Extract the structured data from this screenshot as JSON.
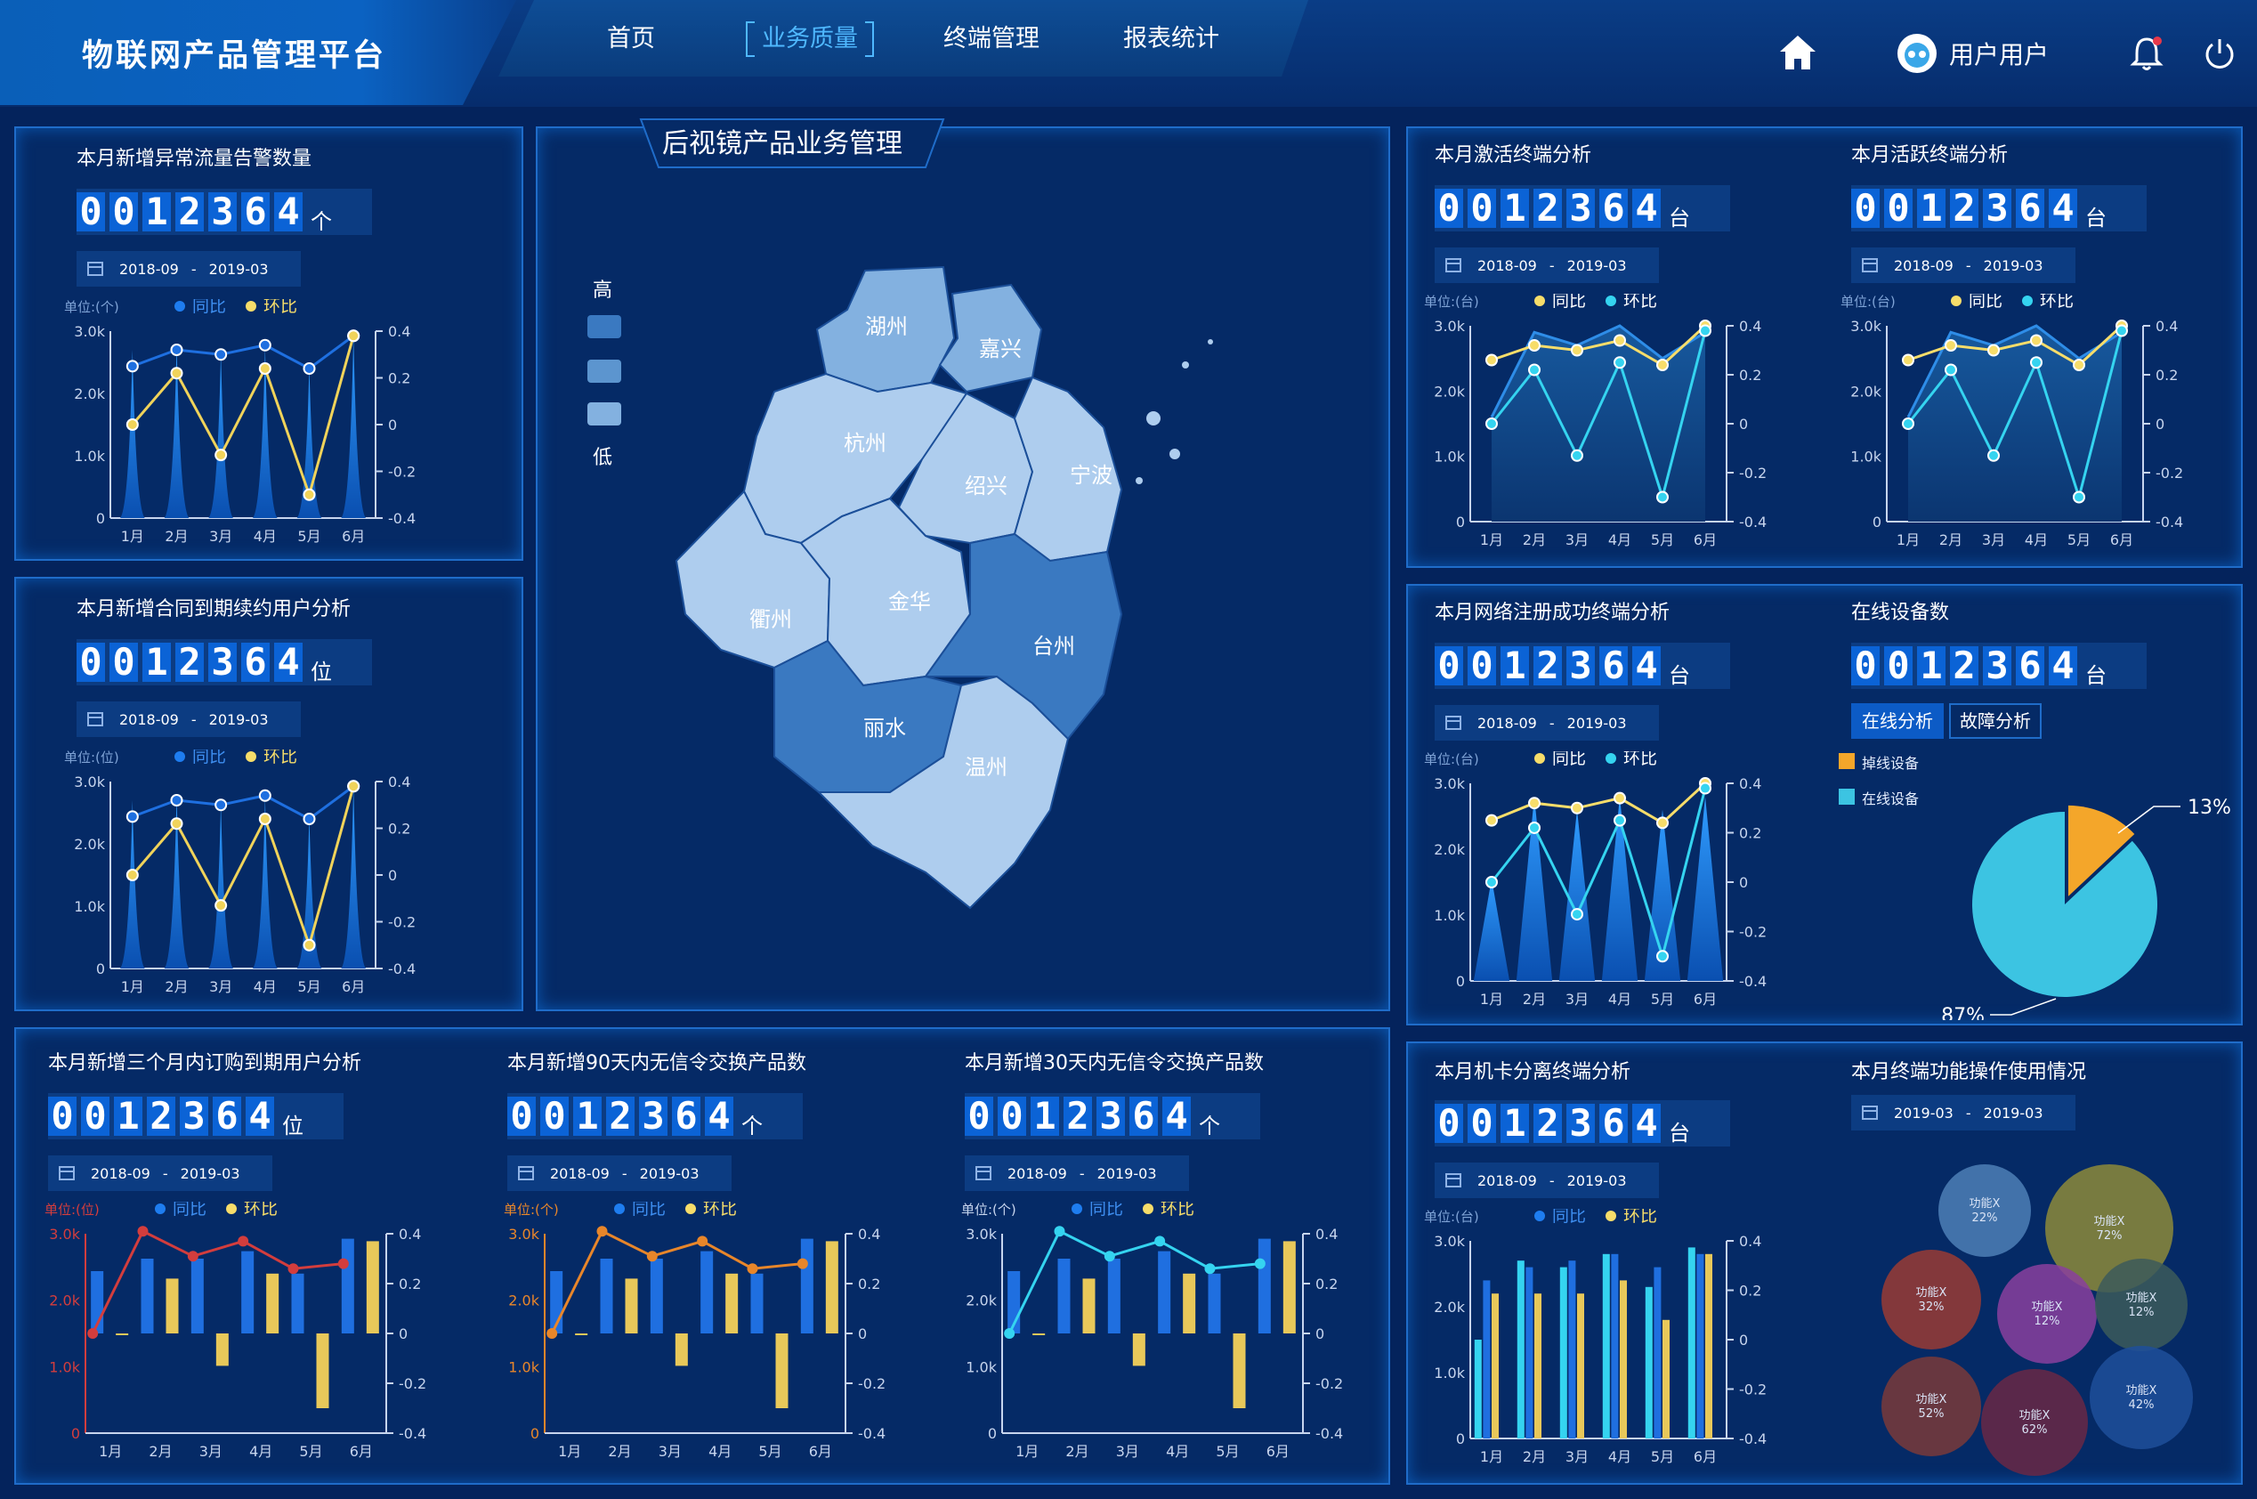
{
  "header": {
    "title": "物联网产品管理平台",
    "nav": [
      {
        "label": "首页"
      },
      {
        "label": "业务质量"
      },
      {
        "label": "终端管理"
      },
      {
        "label": "报表统计"
      }
    ],
    "active_nav": 1,
    "user": "用户用户",
    "icons": {
      "home": "home-icon",
      "avatar": "robot-avatar-icon",
      "bell": "bell-icon",
      "power": "power-icon"
    },
    "accent": "#4fb8ff"
  },
  "date": {
    "from": "2018-09",
    "to": "2019-03",
    "sep": "-"
  },
  "date_single": {
    "from": "2019-03",
    "to": "2019-03",
    "sep": "-"
  },
  "counter_digits": [
    "0",
    "0",
    "1",
    "2",
    "3",
    "6",
    "4"
  ],
  "legend": {
    "yoy": "同比",
    "mom": "环比"
  },
  "map": {
    "title": "后视镜产品业务管理",
    "legend_high": "高",
    "legend_low": "低",
    "regions": [
      {
        "name": "湖州",
        "level": 2
      },
      {
        "name": "嘉兴",
        "level": 2
      },
      {
        "name": "杭州",
        "level": 3
      },
      {
        "name": "绍兴",
        "level": 3
      },
      {
        "name": "宁波",
        "level": 3
      },
      {
        "name": "衢州",
        "level": 3
      },
      {
        "name": "金华",
        "level": 3
      },
      {
        "name": "台州",
        "level": 1
      },
      {
        "name": "丽水",
        "level": 1
      },
      {
        "name": "温州",
        "level": 3
      }
    ]
  },
  "panels": {
    "p1": {
      "title": "本月新增异常流量告警数量",
      "unit": "个",
      "y_unit": "单位:(个)"
    },
    "p2": {
      "title": "本月新增合同到期续约用户分析",
      "unit": "位",
      "y_unit": "单位:(位)"
    },
    "p3": {
      "title": "本月新增三个月内订购到期用户分析",
      "unit": "位",
      "y_unit": "单位:(位)"
    },
    "p4": {
      "title": "本月新增90天内无信令交换产品数",
      "unit": "个",
      "y_unit": "单位:(个)"
    },
    "p5": {
      "title": "本月新增30天内无信令交换产品数",
      "unit": "个",
      "y_unit": "单位:(个)"
    },
    "r1": {
      "title": "本月激活终端分析",
      "unit": "台",
      "y_unit": "单位:(台)"
    },
    "r2": {
      "title": "本月活跃终端分析",
      "unit": "台",
      "y_unit": "单位:(台)"
    },
    "r3": {
      "title": "本月网络注册成功终端分析",
      "unit": "台",
      "y_unit": "单位:(台)"
    },
    "r4": {
      "title": "在线设备数",
      "unit": "台",
      "tab1": "在线分析",
      "tab2": "故障分析",
      "legend1": "掉线设备",
      "legend2": "在线设备",
      "pct_small": "13%",
      "pct_large": "87%"
    },
    "r5": {
      "title": "本月机卡分离终端分析",
      "unit": "台",
      "y_unit": "单位:(台)"
    },
    "r6": {
      "title": "本月终端功能操作使用情况"
    }
  },
  "chart_data": [
    {
      "id": "spike",
      "type": "area",
      "categories": [
        "1月",
        "2月",
        "3月",
        "4月",
        "5月",
        "6月"
      ],
      "y_ticks": [
        "3.0k",
        "2.0k",
        "1.0k",
        "0"
      ],
      "y2_ticks": [
        "0.4",
        "0.2",
        "0",
        "-0.2",
        "-0.4"
      ],
      "ylim": [
        0,
        3000
      ],
      "y2lim": [
        -0.4,
        0.4
      ],
      "series": [
        {
          "name": "同比",
          "values": [
            0.25,
            0.32,
            0.3,
            0.34,
            0.24,
            0.38
          ]
        },
        {
          "name": "环比",
          "values": [
            0.0,
            0.22,
            -0.13,
            0.24,
            -0.3,
            0.38
          ]
        }
      ],
      "area_peaks": [
        2700,
        2800,
        2650,
        2750,
        2450,
        2950
      ]
    },
    {
      "id": "activated",
      "type": "line",
      "categories": [
        "1月",
        "2月",
        "3月",
        "4月",
        "5月",
        "6月"
      ],
      "y_ticks": [
        "3.0k",
        "2.0k",
        "1.0k",
        "0"
      ],
      "y2_ticks": [
        "0.4",
        "0.2",
        "0",
        "-0.2",
        "-0.4"
      ],
      "series": [
        {
          "name": "同比",
          "values": [
            0.26,
            0.32,
            0.3,
            0.34,
            0.24,
            0.4
          ]
        },
        {
          "name": "环比",
          "values": [
            0.0,
            0.22,
            -0.13,
            0.25,
            -0.3,
            0.38
          ]
        }
      ],
      "area_values": [
        1600,
        2900,
        2700,
        3000,
        2500,
        2900
      ]
    },
    {
      "id": "registered",
      "type": "area",
      "categories": [
        "1月",
        "2月",
        "3月",
        "4月",
        "5月",
        "6月"
      ],
      "y_ticks": [
        "3.0k",
        "2.0k",
        "1.0k",
        "0"
      ],
      "y2_ticks": [
        "0.4",
        "0.2",
        "0",
        "-0.2",
        "-0.4"
      ],
      "series": [
        {
          "name": "同比",
          "values": [
            0.25,
            0.32,
            0.3,
            0.34,
            0.24,
            0.4
          ]
        },
        {
          "name": "环比",
          "values": [
            0.0,
            0.22,
            -0.13,
            0.25,
            -0.3,
            0.38
          ]
        }
      ],
      "area_peaks": [
        1550,
        2800,
        2600,
        2800,
        2600,
        2800
      ]
    },
    {
      "id": "bars_a",
      "type": "bar",
      "categories": [
        "1月",
        "2月",
        "3月",
        "4月",
        "5月",
        "6月"
      ],
      "y_ticks": [
        "3.0k",
        "2.0k",
        "1.0k",
        "0"
      ],
      "y2_ticks": [
        "0.4",
        "0.2",
        "0",
        "-0.2",
        "-0.4"
      ],
      "bars_pos": [
        [
          0.25,
          0
        ],
        [
          0.3,
          0.22
        ],
        [
          0.3,
          -0.13
        ],
        [
          0.33,
          0.24
        ],
        [
          0.24,
          -0.3
        ],
        [
          0.38,
          0.37
        ]
      ],
      "line": [
        -0.0,
        0.41,
        0.31,
        0.37,
        0.26,
        0.28
      ]
    },
    {
      "id": "bars_r5",
      "type": "bar",
      "categories": [
        "1月",
        "2月",
        "3月",
        "4月",
        "5月",
        "6月"
      ],
      "y_ticks": [
        "3.0k",
        "2.0k",
        "1.0k",
        "0"
      ],
      "y2_ticks": [
        "0.4",
        "0.2",
        "0",
        "-0.2",
        "-0.4"
      ],
      "bars_cyan": [
        1500,
        2700,
        2600,
        2800,
        2300,
        2900
      ],
      "bars_blue": [
        2400,
        2600,
        2700,
        2800,
        2600,
        2800
      ],
      "bars_yellow": [
        2200,
        2200,
        2200,
        2400,
        1800,
        2800
      ]
    },
    {
      "id": "pie",
      "type": "pie",
      "values": [
        13,
        87
      ],
      "labels": [
        "13%",
        "87%"
      ],
      "colors": [
        "#f4a62a",
        "#3cc4e2"
      ]
    },
    {
      "id": "bubbles",
      "type": "scatter",
      "label": "功能X",
      "items": [
        {
          "pct": "22%",
          "color": "#4e7fb6"
        },
        {
          "pct": "72%",
          "color": "#8d8a3a"
        },
        {
          "pct": "32%",
          "color": "#9a3b34"
        },
        {
          "pct": "12%",
          "color": "#8a3f9e"
        },
        {
          "pct": "12%",
          "color": "#3c5a5a"
        },
        {
          "pct": "52%",
          "color": "#7a3a3a"
        },
        {
          "pct": "62%",
          "color": "#6a2845"
        },
        {
          "pct": "42%",
          "color": "#1f4f9a"
        }
      ]
    }
  ]
}
